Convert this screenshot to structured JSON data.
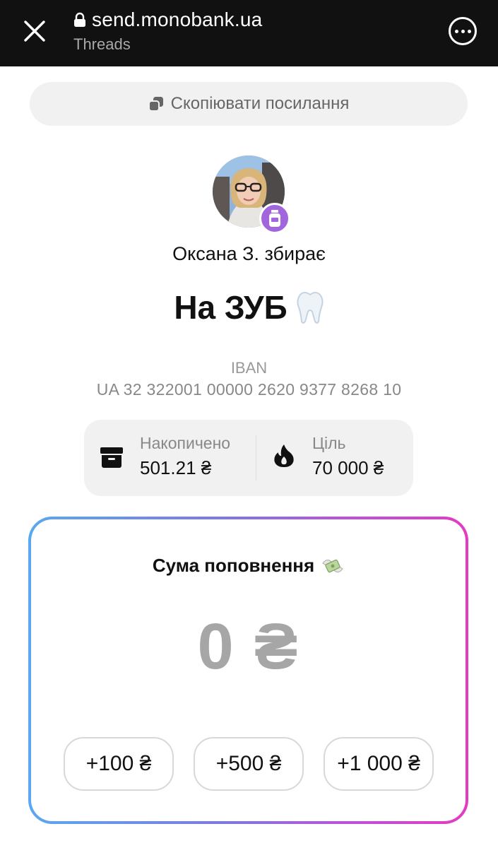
{
  "browser": {
    "url": "send.monobank.ua",
    "source": "Threads"
  },
  "copy_link": {
    "label": "Скопіювати посилання"
  },
  "jar": {
    "collector": "Оксана З. збирає",
    "title": "На ЗУБ",
    "iban_label": "IBAN",
    "iban": "UA 32 322001 00000 2620 9377 8268 10"
  },
  "stats": {
    "saved_label": "Накопичено",
    "saved_value": "501.21 ₴",
    "goal_label": "Ціль",
    "goal_value": "70 000 ₴"
  },
  "topup": {
    "title": "Сума поповнення",
    "amount": "0 ₴",
    "presets": [
      "+100 ₴",
      "+500 ₴",
      "+1 000 ₴"
    ]
  },
  "colors": {
    "accent_purple": "#a365de",
    "gradient_start": "#5aa8ef",
    "gradient_end": "#e33bc1"
  }
}
